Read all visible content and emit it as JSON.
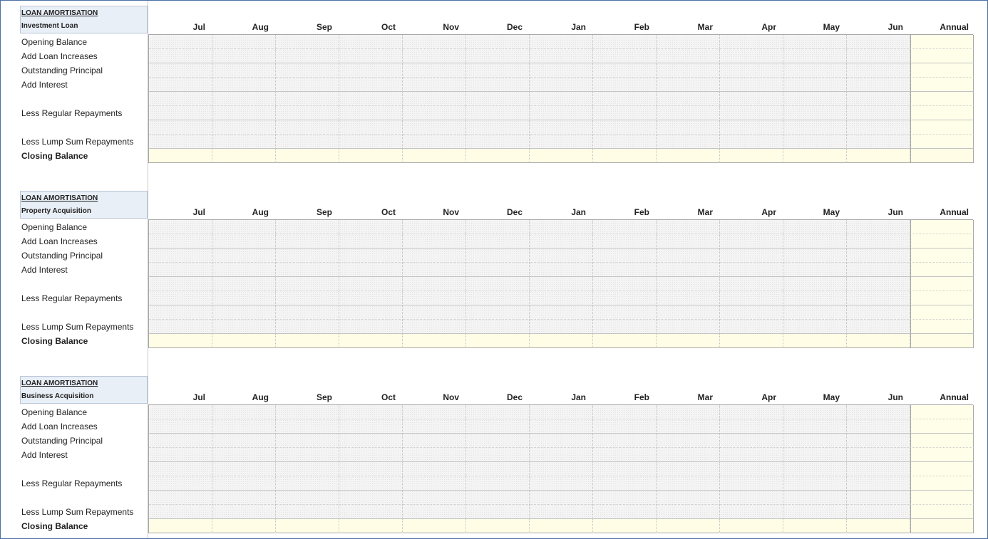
{
  "months": [
    "Jul",
    "Aug",
    "Sep",
    "Oct",
    "Nov",
    "Dec",
    "Jan",
    "Feb",
    "Mar",
    "Apr",
    "May",
    "Jun"
  ],
  "annual_label": "Annual",
  "row_labels": [
    {
      "text": "Opening Balance",
      "bold": false
    },
    {
      "text": "Add Loan Increases",
      "bold": false
    },
    {
      "text": "Outstanding Principal",
      "bold": false
    },
    {
      "text": "Add Interest",
      "bold": false
    },
    {
      "text": "",
      "bold": false
    },
    {
      "text": "Less Regular Repayments",
      "bold": false
    },
    {
      "text": "",
      "bold": false
    },
    {
      "text": "Less Lump Sum Repayments",
      "bold": false
    },
    {
      "text": "Closing Balance",
      "bold": true
    }
  ],
  "sections": [
    {
      "title": "LOAN AMORTISATION",
      "subtitle": "Investment Loan"
    },
    {
      "title": "LOAN AMORTISATION",
      "subtitle": "Property Acquisition"
    },
    {
      "title": "LOAN AMORTISATION",
      "subtitle": "Business Acquisition"
    }
  ],
  "colors": {
    "input_cell": "#f4f4f4",
    "annual_cell": "#fffee8",
    "header_box": "#e9eff7",
    "frame_border": "#4a6fa5"
  }
}
